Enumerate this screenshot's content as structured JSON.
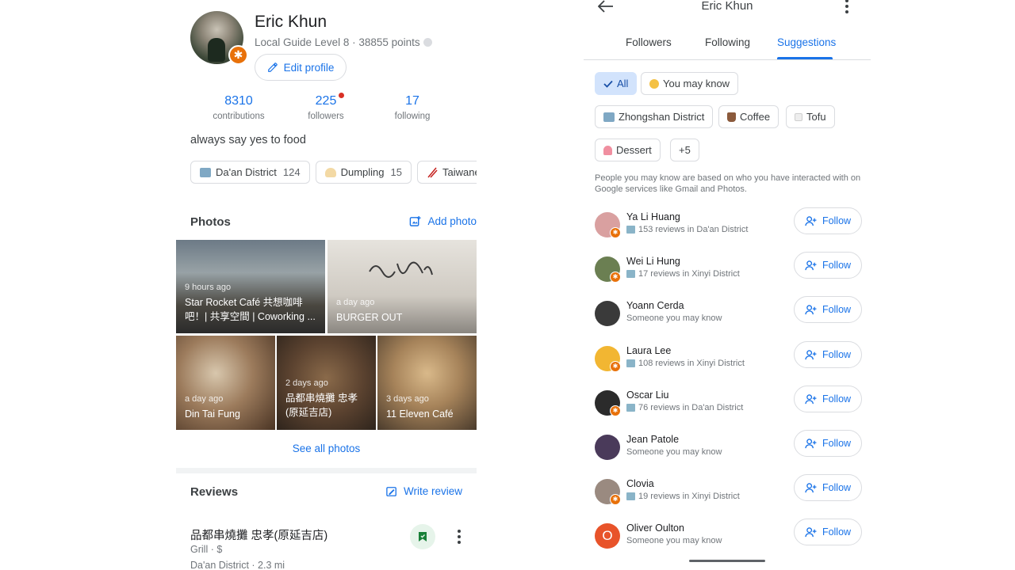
{
  "profile": {
    "name": "Eric Khun",
    "level": "Local Guide Level 8 · 38855 points",
    "edit_label": "Edit profile",
    "stats": [
      {
        "value": "8310",
        "label": "contributions"
      },
      {
        "value": "225",
        "label": "followers"
      },
      {
        "value": "17",
        "label": "following"
      }
    ],
    "bio": "always say yes to food",
    "tags": [
      {
        "icon": "city-icon",
        "label": "Da'an District",
        "count": "124"
      },
      {
        "icon": "dumpling-icon",
        "label": "Dumpling",
        "count": "15"
      },
      {
        "icon": "chopsticks-icon",
        "label": "Taiwanes",
        "count": ""
      }
    ]
  },
  "photos": {
    "title": "Photos",
    "add_label": "Add photo",
    "items": [
      {
        "time": "9 hours ago",
        "caption": "Star Rocket Café 共想咖啡吧！| 共享空間 | Coworking ..."
      },
      {
        "time": "a day ago",
        "caption": "BURGER OUT"
      },
      {
        "time": "a day ago",
        "caption": "Din Tai Fung"
      },
      {
        "time": "2 days ago",
        "caption": "品都串燒攤 忠孝(原延吉店)"
      },
      {
        "time": "3 days ago",
        "caption": "11 Eleven Café"
      }
    ],
    "see_all": "See all photos"
  },
  "reviews": {
    "title": "Reviews",
    "write_label": "Write review",
    "first": {
      "name": "品都串燒攤 忠孝(原延吉店)",
      "category": "Grill · $",
      "location": "Da'an District · 2.3 mi"
    }
  },
  "social": {
    "title": "Eric Khun",
    "tabs": [
      {
        "label": "Followers",
        "active": false
      },
      {
        "label": "Following",
        "active": false
      },
      {
        "label": "Suggestions",
        "active": true
      }
    ],
    "chips": [
      {
        "label": "All",
        "icon": "check-icon",
        "selected": true
      },
      {
        "label": "You may know",
        "icon": "waving-hand-icon",
        "selected": false
      },
      {
        "label": "Zhongshan District",
        "icon": "city-icon",
        "selected": false
      },
      {
        "label": "Coffee",
        "icon": "coffee-icon",
        "selected": false
      },
      {
        "label": "Tofu",
        "icon": "tofu-icon",
        "selected": false
      },
      {
        "label": "Dessert",
        "icon": "dessert-icon",
        "selected": false
      },
      {
        "label": "+5",
        "icon": "",
        "selected": false
      }
    ],
    "info": "People you may know are based on who you have interacted with on Google services like Gmail and Photos.",
    "follow_label": "Follow",
    "people": [
      {
        "name": "Ya Li Huang",
        "sub": "153 reviews in Da'an District",
        "guide": true,
        "avatar_color": "#d9a0a0",
        "initial": ""
      },
      {
        "name": "Wei Li Hung",
        "sub": "17 reviews in Xinyi District",
        "guide": true,
        "avatar_color": "#6b7f52",
        "initial": ""
      },
      {
        "name": "Yoann Cerda",
        "sub": "Someone you may know",
        "guide": false,
        "avatar_color": "#3a3a3a",
        "initial": ""
      },
      {
        "name": "Laura Lee",
        "sub": "108 reviews in Xinyi District",
        "guide": true,
        "avatar_color": "#f2b632",
        "initial": ""
      },
      {
        "name": "Oscar Liu",
        "sub": "76 reviews in Da'an District",
        "guide": true,
        "avatar_color": "#2b2b2b",
        "initial": ""
      },
      {
        "name": "Jean Patole",
        "sub": "Someone you may know",
        "guide": false,
        "avatar_color": "#4a3a5a",
        "initial": ""
      },
      {
        "name": "Clovia",
        "sub": "19 reviews in Xinyi District",
        "guide": true,
        "avatar_color": "#9a8a80",
        "initial": ""
      },
      {
        "name": "Oliver Oulton",
        "sub": "Someone you may know",
        "guide": false,
        "avatar_color": "#e8532a",
        "initial": "O"
      }
    ]
  }
}
